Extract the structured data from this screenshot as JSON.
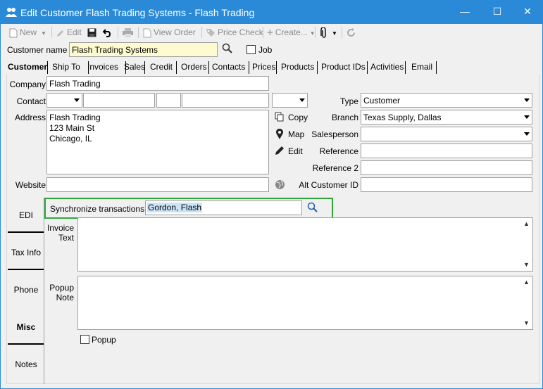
{
  "window": {
    "title": "Edit Customer Flash Trading Systems - Flash Trading",
    "min_glyph": "—",
    "max_glyph": "☐",
    "close_glyph": "✕",
    "title_color": "#2b8ad8"
  },
  "toolbar": {
    "new_label": "New",
    "edit_label": "Edit",
    "view_order_label": "View Order",
    "price_check_label": "Price Check",
    "create_label": "Create..."
  },
  "header": {
    "customer_name_label": "Customer name",
    "customer_name_value": "Flash Trading Systems",
    "job_label": "Job"
  },
  "tabs": [
    {
      "label": "Customer"
    },
    {
      "label": "Ship To"
    },
    {
      "label": "Invoices"
    },
    {
      "label": "Sales"
    },
    {
      "label": "Credit"
    },
    {
      "label": "Orders"
    },
    {
      "label": "Contacts"
    },
    {
      "label": "Prices"
    },
    {
      "label": "Products"
    },
    {
      "label": "Product IDs"
    },
    {
      "label": "Activities"
    },
    {
      "label": "Email"
    }
  ],
  "form": {
    "company_label": "Company",
    "company_value": "Flash Trading",
    "contact_label": "Contact",
    "address_label": "Address",
    "address_lines": [
      "Flash Trading",
      "123 Main St",
      "Chicago, IL"
    ],
    "website_label": "Website",
    "website_value": "",
    "copy_label": "Copy",
    "map_label": "Map",
    "edit_label": "Edit",
    "type_label": "Type",
    "type_value": "Customer",
    "branch_label": "Branch",
    "branch_value": "Texas Supply, Dallas",
    "salesperson_label": "Salesperson",
    "salesperson_value": "",
    "reference_label": "Reference",
    "reference2_label": "Reference 2",
    "alt_customer_id_label": "Alt Customer ID"
  },
  "side_tabs": [
    {
      "label": "EDI"
    },
    {
      "label": "Tax Info"
    },
    {
      "label": "Phone"
    },
    {
      "label": "Misc"
    },
    {
      "label": "Notes"
    }
  ],
  "misc": {
    "sync_label": "Synchronize transactions",
    "sync_value": "Gordon, Flash",
    "invoice_text_label_1": "Invoice",
    "invoice_text_label_2": "Text",
    "popup_note_label_1": "Popup",
    "popup_note_label_2": "Note",
    "popup_checkbox_label": "Popup",
    "highlight_color": "#2fa83a",
    "selection_color": "#cce4f7"
  }
}
